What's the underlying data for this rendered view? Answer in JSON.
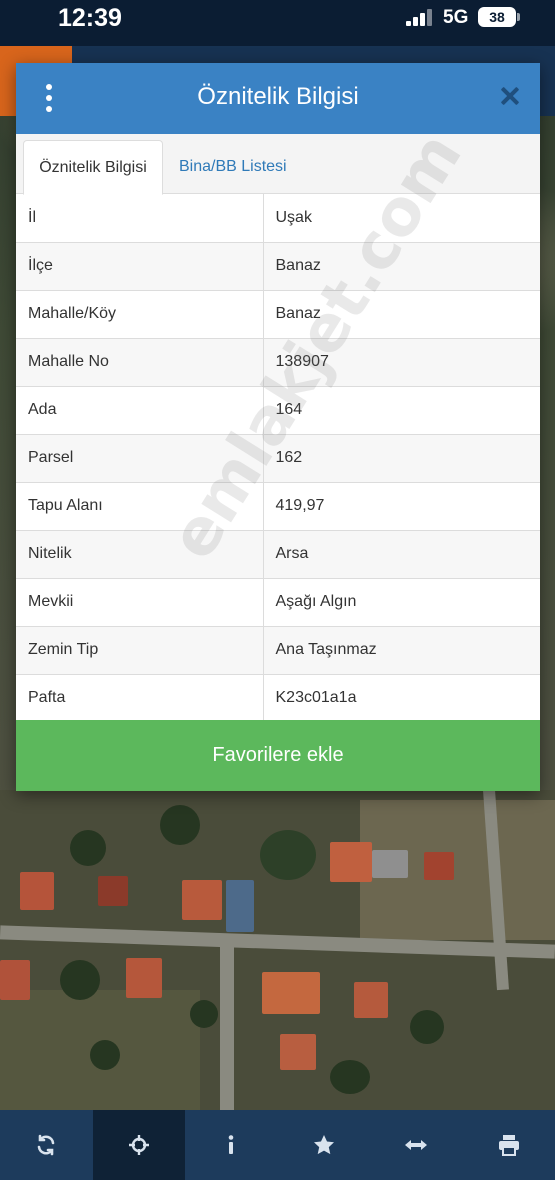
{
  "status_bar": {
    "time": "12:39",
    "network": "5G",
    "battery": "38"
  },
  "modal": {
    "title": "Öznitelik Bilgisi",
    "tabs": [
      {
        "label": "Öznitelik Bilgisi",
        "active": true
      },
      {
        "label": "Bina/BB Listesi",
        "active": false
      }
    ],
    "rows": [
      {
        "key": "İl",
        "value": "Uşak"
      },
      {
        "key": "İlçe",
        "value": "Banaz"
      },
      {
        "key": "Mahalle/Köy",
        "value": "Banaz"
      },
      {
        "key": "Mahalle No",
        "value": "138907"
      },
      {
        "key": "Ada",
        "value": "164"
      },
      {
        "key": "Parsel",
        "value": "162"
      },
      {
        "key": "Tapu Alanı",
        "value": "419,97"
      },
      {
        "key": "Nitelik",
        "value": "Arsa"
      },
      {
        "key": "Mevkii",
        "value": "Aşağı Algın"
      },
      {
        "key": "Zemin Tip",
        "value": "Ana Taşınmaz"
      },
      {
        "key": "Pafta",
        "value": "K23c01a1a"
      }
    ],
    "favorite_button": "Favorilere ekle",
    "watermark": "emlakjet.com"
  },
  "toolbar": {
    "items": [
      {
        "icon": "refresh-icon",
        "active": false
      },
      {
        "icon": "crosshair-icon",
        "active": true
      },
      {
        "icon": "info-icon",
        "active": false
      },
      {
        "icon": "star-icon",
        "active": false
      },
      {
        "icon": "measure-icon",
        "active": false
      },
      {
        "icon": "print-icon",
        "active": false
      }
    ]
  },
  "colors": {
    "header_blue": "#3a82c4",
    "tab_link": "#2f7ab8",
    "button_green": "#5cb85c",
    "toolbar": "#1d3b5c"
  }
}
